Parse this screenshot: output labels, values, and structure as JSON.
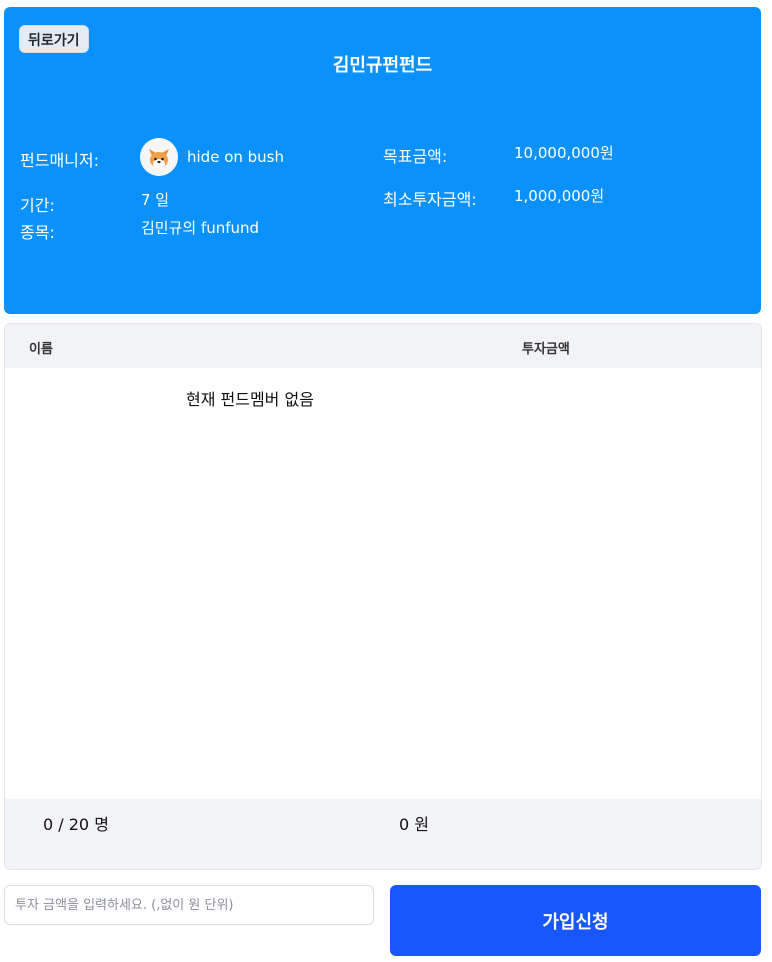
{
  "header": {
    "back_label": "뒤로가기",
    "title": "김민규펀펀드"
  },
  "fund_info": {
    "manager_label": "펀드매니저:",
    "manager_name": "hide on bush",
    "period_label": "기간:",
    "period_value": "7 일",
    "item_label": "종목:",
    "item_value": "김민규의 funfund",
    "target_label": "목표금액:",
    "target_value": "10,000,000원",
    "min_label": "최소투자금액:",
    "min_value": "1,000,000원"
  },
  "members_table": {
    "columns": [
      "이름",
      "투자금액"
    ],
    "empty_message": "현재 펀드멤버 없음",
    "member_count": "0 / 20 명",
    "total_amount": "0 원"
  },
  "join_form": {
    "amount_placeholder": "투자 금액을 입력하세요. (,없이 원 단위)",
    "submit_label": "가입신청"
  },
  "colors": {
    "hero_bg": "#0a91fb",
    "primary_button": "#1757fb",
    "table_header_bg": "#f2f3f7"
  },
  "icons": {
    "avatar": "corgi-avatar-icon"
  }
}
